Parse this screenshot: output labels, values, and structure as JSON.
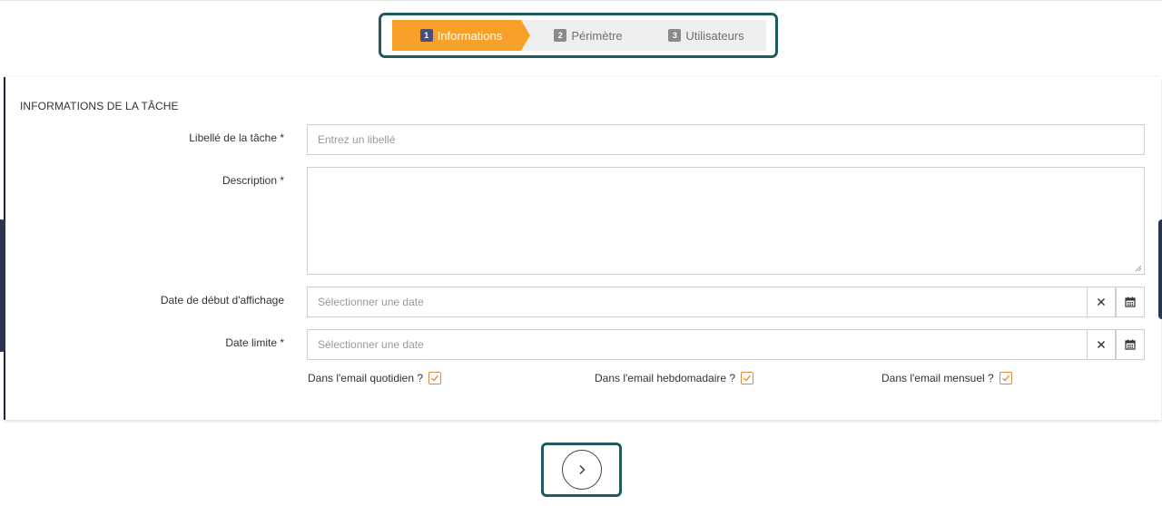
{
  "stepper": {
    "steps": [
      {
        "num": "1",
        "label": "Informations",
        "state": "active"
      },
      {
        "num": "2",
        "label": "Périmètre",
        "state": "inactive"
      },
      {
        "num": "3",
        "label": "Utilisateurs",
        "state": "inactive"
      }
    ]
  },
  "form": {
    "section_title": "INFORMATIONS DE LA TÂCHE",
    "task_label": {
      "label": "Libellé de la tâche *",
      "placeholder": "Entrez un libellé"
    },
    "description": {
      "label": "Description *"
    },
    "display_start_date": {
      "label": "Date de début d'affichage",
      "placeholder": "Sélectionner une date"
    },
    "due_date": {
      "label": "Date limite *",
      "placeholder": "Sélectionner une date"
    },
    "checkboxes": [
      {
        "label": "Dans l'email quotidien ?",
        "checked": true
      },
      {
        "label": "Dans l'email hebdomadaire ?",
        "checked": true
      },
      {
        "label": "Dans l'email mensuel ?",
        "checked": true
      }
    ]
  },
  "icons": {
    "clear": "close-icon",
    "calendar": "calendar-icon",
    "next": "chevron-right-icon"
  },
  "colors": {
    "active_step": "#f7a12a",
    "inactive_step": "#efefef",
    "highlight_frame": "#1f5a5e",
    "checkbox": "#e3883a"
  }
}
